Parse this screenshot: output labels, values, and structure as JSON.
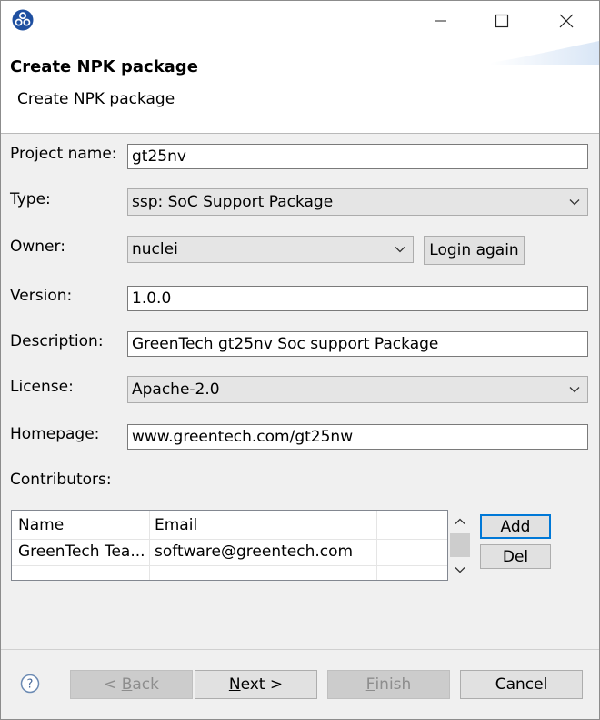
{
  "window": {
    "title_buttons": {
      "minimize_icon": "minimize-icon",
      "maximize_icon": "maximize-icon",
      "close_icon": "close-icon"
    }
  },
  "banner": {
    "title": "Create NPK package",
    "message": "Create NPK package"
  },
  "form": {
    "project_name_label": "Project name:",
    "project_name_value": "gt25nv",
    "type_label": "Type:",
    "type_value": "ssp: SoC Support Package",
    "owner_label": "Owner:",
    "owner_value": "nuclei",
    "login_again_label": "Login again",
    "version_label": "Version:",
    "version_value": "1.0.0",
    "description_label": "Description:",
    "description_value": "GreenTech gt25nv Soc support Package",
    "license_label": "License:",
    "license_value": "Apache-2.0",
    "homepage_label": "Homepage:",
    "homepage_value": "www.greentech.com/gt25nw",
    "contributors_label": "Contributors:"
  },
  "contributors_table": {
    "columns": [
      "Name",
      "Email"
    ],
    "rows": [
      {
        "name": "GreenTech Tea...",
        "email": "software@greentech.com"
      }
    ],
    "add_label": "Add",
    "del_label": "Del"
  },
  "footer": {
    "back_prefix": "< ",
    "back_mnemonic": "B",
    "back_rest": "ack",
    "next_mnemonic": "N",
    "next_rest": "ext >",
    "finish_mnemonic": "F",
    "finish_rest": "inish",
    "cancel_label": "Cancel"
  },
  "colors": {
    "accent": "#0078d7",
    "app_icon": "#1e4fa0",
    "disabled_text": "#8d8d8d"
  }
}
